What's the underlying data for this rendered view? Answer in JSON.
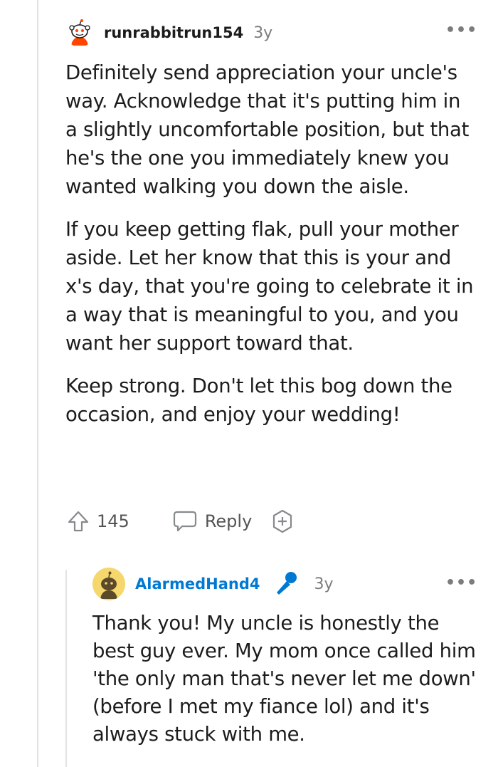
{
  "comment": {
    "username": "runrabbitrun154",
    "age": "3y",
    "more_label": "•••",
    "paragraphs": [
      "Definitely send appreciation your uncle's way. Acknowledge that it's putting him in a slightly uncomfortable position, but that he's the one you immediately knew you wanted walking you down the aisle.",
      "If you keep getting flak, pull your mother aside. Let her know that this is your and x's day, that you're going to celebrate it in a way that is meaningful to you, and you want her support toward that.",
      "Keep strong. Don't let this bog down the occasion, and enjoy your wedding!"
    ],
    "upvote_count": "145",
    "reply_label": "Reply",
    "avatar_icon": "snoo-avatar-icon",
    "colors": {
      "avatar_accent": "#ff4500"
    }
  },
  "reply": {
    "username": "AlarmedHand4",
    "username_color": "#0079d3",
    "age": "3y",
    "more_label": "•••",
    "badge_icon": "microphone-icon",
    "paragraph": "Thank you! My uncle is honestly the best guy ever. My mom once called him 'the only man that's never let me down' (before I met my fiance lol) and it's always stuck with me.",
    "avatar_icon": "snoo-avatar-icon",
    "colors": {
      "avatar_bg": "#f5d76e",
      "badge": "#0079d3"
    }
  }
}
